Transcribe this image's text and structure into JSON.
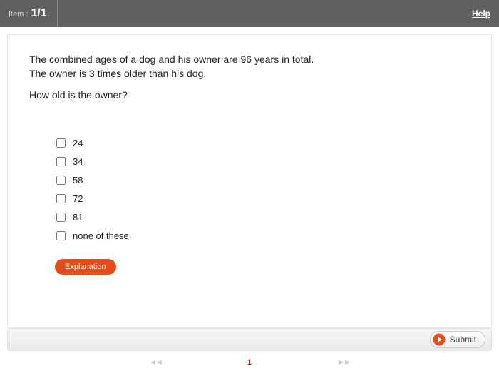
{
  "header": {
    "item_label": "Item :",
    "item_count": "1/1",
    "help": "Help"
  },
  "question": {
    "line1": "The combined ages of a dog and his owner are 96 years in total.",
    "line2": "The owner is 3 times older than  his dog.",
    "ask": "How old is the owner?"
  },
  "options": [
    {
      "label": "24"
    },
    {
      "label": "34"
    },
    {
      "label": "58"
    },
    {
      "label": "72"
    },
    {
      "label": "81"
    },
    {
      "label": "none of these"
    }
  ],
  "buttons": {
    "explanation": "Explanation",
    "submit": "Submit"
  },
  "pager": {
    "prev": "◄◄",
    "page": "1",
    "next": "►►"
  },
  "colors": {
    "accent": "#e64c1a",
    "header": "#615f5f"
  }
}
